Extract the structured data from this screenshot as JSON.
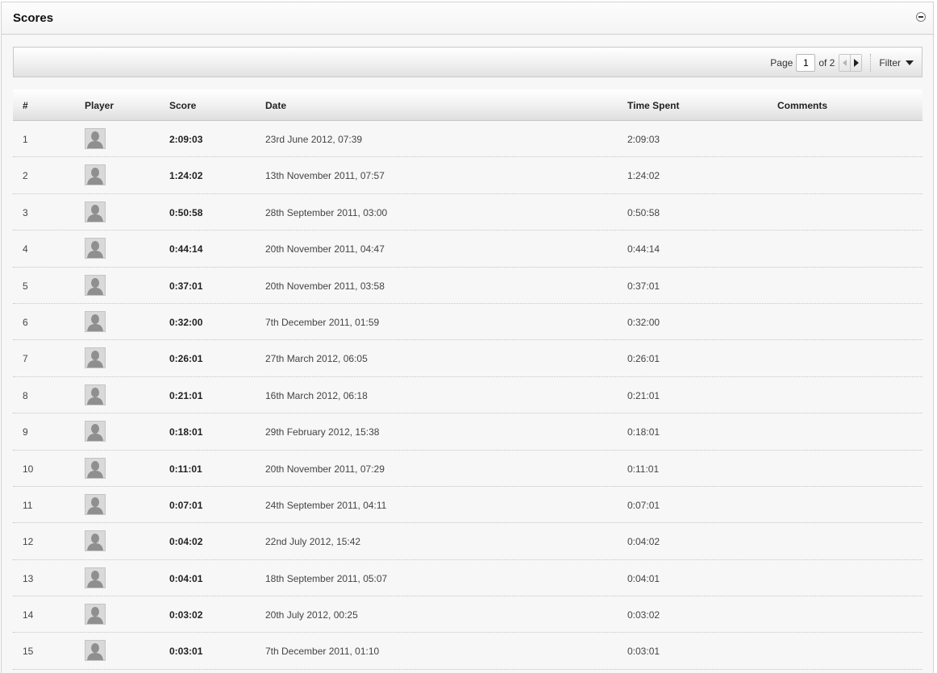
{
  "panel": {
    "title": "Scores"
  },
  "pager": {
    "page_label": "Page",
    "current_page": "1",
    "of_label": "of 2",
    "filter_label": "Filter"
  },
  "columns": [
    "#",
    "Player",
    "Score",
    "Date",
    "Time Spent",
    "Comments"
  ],
  "rows": [
    {
      "num": "1",
      "score": "2:09:03",
      "date": "23rd June 2012, 07:39",
      "time": "2:09:03",
      "comments": ""
    },
    {
      "num": "2",
      "score": "1:24:02",
      "date": "13th November 2011, 07:57",
      "time": "1:24:02",
      "comments": ""
    },
    {
      "num": "3",
      "score": "0:50:58",
      "date": "28th September 2011, 03:00",
      "time": "0:50:58",
      "comments": ""
    },
    {
      "num": "4",
      "score": "0:44:14",
      "date": "20th November 2011, 04:47",
      "time": "0:44:14",
      "comments": ""
    },
    {
      "num": "5",
      "score": "0:37:01",
      "date": "20th November 2011, 03:58",
      "time": "0:37:01",
      "comments": ""
    },
    {
      "num": "6",
      "score": "0:32:00",
      "date": "7th December 2011, 01:59",
      "time": "0:32:00",
      "comments": ""
    },
    {
      "num": "7",
      "score": "0:26:01",
      "date": "27th March 2012, 06:05",
      "time": "0:26:01",
      "comments": ""
    },
    {
      "num": "8",
      "score": "0:21:01",
      "date": "16th March 2012, 06:18",
      "time": "0:21:01",
      "comments": ""
    },
    {
      "num": "9",
      "score": "0:18:01",
      "date": "29th February 2012, 15:38",
      "time": "0:18:01",
      "comments": ""
    },
    {
      "num": "10",
      "score": "0:11:01",
      "date": "20th November 2011, 07:29",
      "time": "0:11:01",
      "comments": ""
    },
    {
      "num": "11",
      "score": "0:07:01",
      "date": "24th September 2011, 04:11",
      "time": "0:07:01",
      "comments": ""
    },
    {
      "num": "12",
      "score": "0:04:02",
      "date": "22nd July 2012, 15:42",
      "time": "0:04:02",
      "comments": ""
    },
    {
      "num": "13",
      "score": "0:04:01",
      "date": "18th September 2011, 05:07",
      "time": "0:04:01",
      "comments": ""
    },
    {
      "num": "14",
      "score": "0:03:02",
      "date": "20th July 2012, 00:25",
      "time": "0:03:02",
      "comments": ""
    },
    {
      "num": "15",
      "score": "0:03:01",
      "date": "7th December 2011, 01:10",
      "time": "0:03:01",
      "comments": ""
    }
  ],
  "icons": {
    "collapse": "minus-circle-icon",
    "prev": "triangle-left-icon",
    "next": "triangle-right-icon",
    "filter": "triangle-down-icon",
    "avatar": "default-user-avatar"
  }
}
